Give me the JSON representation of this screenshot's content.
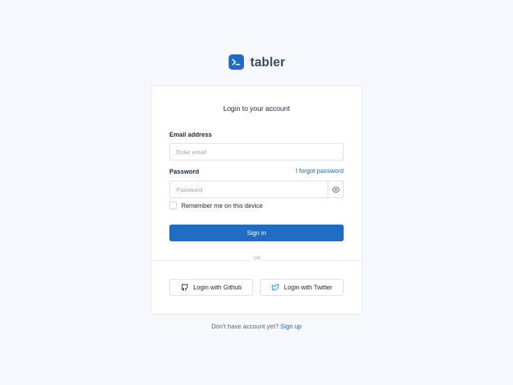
{
  "brand": {
    "name": "tabler",
    "logo_icon": "terminal-icon",
    "accent_color": "#206bc4"
  },
  "login": {
    "title": "Login to your account",
    "email": {
      "label": "Email address",
      "placeholder": "Enter email",
      "value": ""
    },
    "password": {
      "label": "Password",
      "placeholder": "Password",
      "value": "",
      "forgot_label": "I forgot password",
      "toggle_icon": "eye-icon"
    },
    "remember": {
      "label": "Remember me on this device",
      "checked": false
    },
    "submit_label": "Sign in",
    "divider_label": "OR",
    "social": [
      {
        "label": "Login with Github",
        "icon": "github-icon"
      },
      {
        "label": "Login with Twitter",
        "icon": "twitter-icon"
      }
    ]
  },
  "footer": {
    "prompt": "Don't have account yet?",
    "signup_label": "Sign up"
  }
}
